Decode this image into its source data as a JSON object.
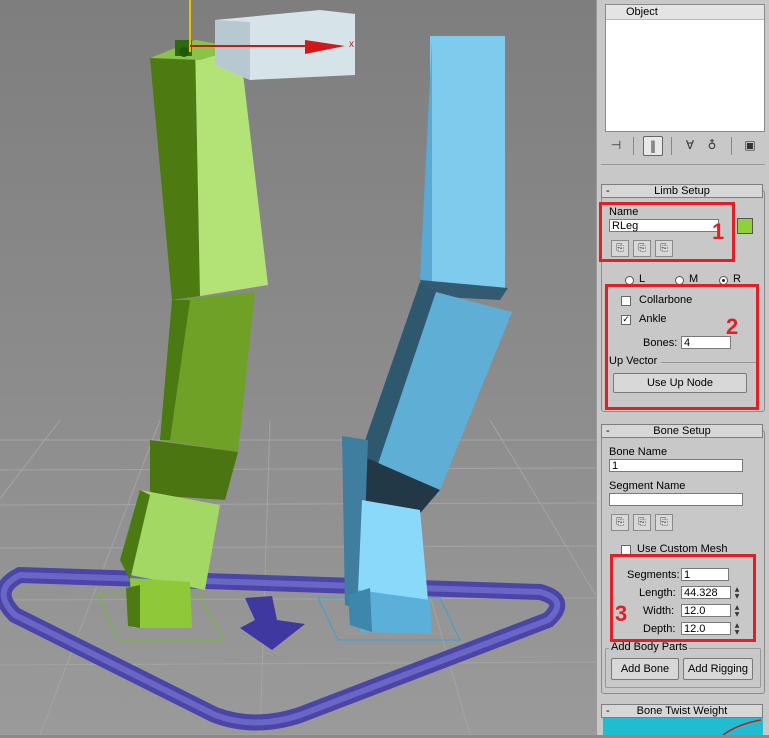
{
  "viewport": {
    "axis_label": "x"
  },
  "panel": {
    "list_header": "Object",
    "toolbar_icons": [
      "pin-stack-icon",
      "show-end-result-icon",
      "make-unique-icon",
      "remove-modifier-icon",
      "configure-modifier-sets-icon"
    ],
    "limb_setup": {
      "title": "Limb Setup",
      "name_label": "Name",
      "name_value": "RLeg",
      "color_swatch": "#8ed23a",
      "side_options": [
        "L",
        "M",
        "R"
      ],
      "side_selected": "R",
      "collarbone_label": "Collarbone",
      "collarbone_checked": false,
      "ankle_label": "Ankle",
      "ankle_checked": true,
      "bones_label": "Bones:",
      "bones_value": "4",
      "up_vector_label": "Up Vector",
      "use_up_node_label": "Use Up Node"
    },
    "bone_setup": {
      "title": "Bone Setup",
      "bone_name_label": "Bone Name",
      "bone_name_value": "1",
      "segment_name_label": "Segment Name",
      "segment_name_value": "",
      "use_custom_mesh_label": "Use Custom Mesh",
      "use_custom_mesh_checked": false,
      "segments_label": "Segments:",
      "segments_value": "1",
      "length_label": "Length:",
      "length_value": "44.328",
      "width_label": "Width:",
      "width_value": "12.0",
      "depth_label": "Depth:",
      "depth_value": "12.0",
      "add_body_parts_label": "Add Body Parts",
      "add_bone_label": "Add Bone",
      "add_rigging_label": "Add Rigging"
    },
    "bone_twist_title": "Bone Twist Weight",
    "minus_symbol": "-"
  },
  "annotations": {
    "n1": "1",
    "n2": "2",
    "n3": "3",
    "color": "#e01f26"
  }
}
